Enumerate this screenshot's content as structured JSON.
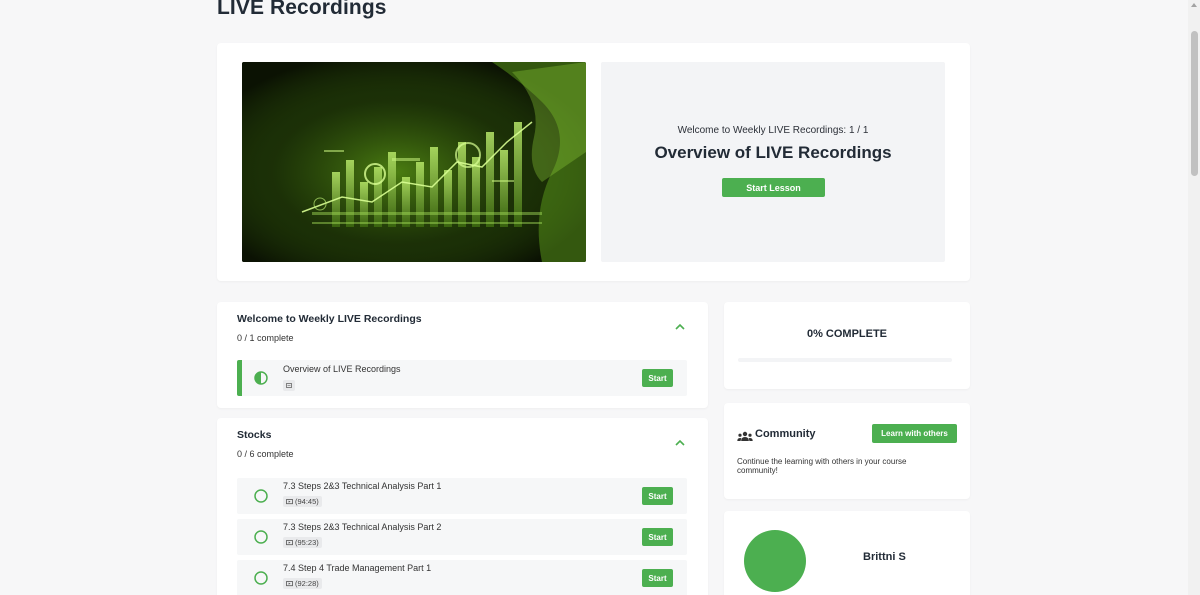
{
  "page": {
    "title": "LIVE Recordings"
  },
  "hero": {
    "subtitle": "Welcome to Weekly LIVE Recordings: 1 / 1",
    "lesson_title": "Overview of LIVE Recordings",
    "start_label": "Start Lesson"
  },
  "sections": [
    {
      "title": "Welcome to Weekly LIVE Recordings",
      "progress": "0 / 1 complete",
      "lessons": [
        {
          "title": "Overview of LIVE Recordings",
          "meta": "",
          "meta_icon": "text-icon",
          "start_label": "Start",
          "status": "in-progress"
        }
      ]
    },
    {
      "title": "Stocks",
      "progress": "0 / 6 complete",
      "lessons": [
        {
          "title": "7.3 Steps 2&3 Technical Analysis Part 1",
          "meta": "(94:45)",
          "meta_icon": "video-icon",
          "start_label": "Start",
          "status": "not-started"
        },
        {
          "title": "7.3 Steps 2&3 Technical Analysis Part 2",
          "meta": "(95:23)",
          "meta_icon": "video-icon",
          "start_label": "Start",
          "status": "not-started"
        },
        {
          "title": "7.4 Step 4 Trade Management Part 1",
          "meta": "(92:28)",
          "meta_icon": "video-icon",
          "start_label": "Start",
          "status": "not-started"
        }
      ]
    }
  ],
  "progress_card": {
    "label": "0% COMPLETE",
    "value": 0
  },
  "community": {
    "title": "Community",
    "button_label": "Learn with others",
    "description": "Continue the learning with others in your course community!"
  },
  "profile": {
    "name": "Brittni S"
  },
  "colors": {
    "accent": "#4caf50",
    "background": "#f7f7f8",
    "panel": "#f3f4f6"
  }
}
